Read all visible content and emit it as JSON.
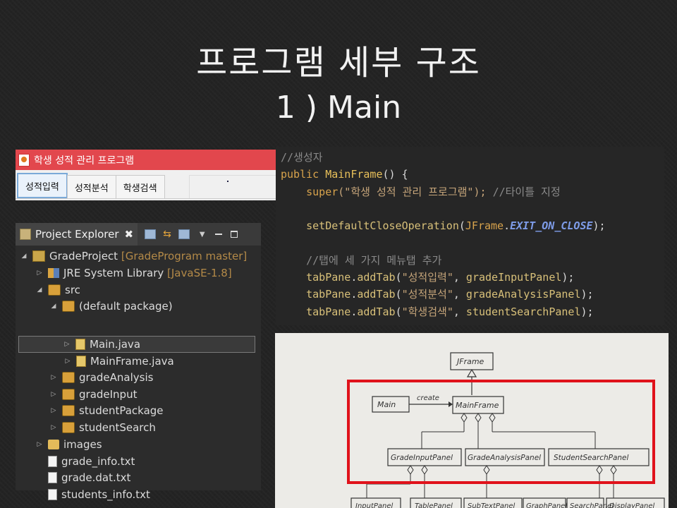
{
  "slide": {
    "title": "프로그램 세부 구조",
    "subtitle": "1 ) Main"
  },
  "app_window": {
    "title": "학생 성적 관리 프로그램",
    "tabs": [
      "성적입력",
      "성적분석",
      "학생검색"
    ],
    "active_tab": "성적입력"
  },
  "project_explorer": {
    "title": "Project Explorer",
    "close_glyph": "✖",
    "tree": [
      {
        "label": "GradeProject",
        "suffix": "[GradeProgram master]",
        "icon": "project-icon"
      },
      {
        "label": "JRE System Library",
        "suffix": "[JavaSE-1.8]",
        "icon": "library-icon"
      },
      {
        "label": "src",
        "suffix": "",
        "icon": "source-folder-icon"
      },
      {
        "label": "(default package)",
        "suffix": "",
        "icon": "package-icon"
      },
      {
        "label": "Main.java",
        "suffix": "",
        "icon": "java-file-icon"
      },
      {
        "label": "MainFrame.java",
        "suffix": "",
        "icon": "java-file-icon"
      },
      {
        "label": "gradeAnalysis",
        "suffix": "",
        "icon": "package-icon"
      },
      {
        "label": "gradeInput",
        "suffix": "",
        "icon": "package-icon"
      },
      {
        "label": "studentPackage",
        "suffix": "",
        "icon": "package-icon"
      },
      {
        "label": "studentSearch",
        "suffix": "",
        "icon": "package-icon"
      },
      {
        "label": "images",
        "suffix": "",
        "icon": "folder-icon"
      },
      {
        "label": "grade_info.txt",
        "suffix": "",
        "icon": "text-file-icon"
      },
      {
        "label": "grade.dat.txt",
        "suffix": "",
        "icon": "text-file-icon"
      },
      {
        "label": "students_info.txt",
        "suffix": "",
        "icon": "text-file-icon"
      }
    ],
    "selected": "Main.java"
  },
  "code": {
    "comment1": "//생성자",
    "public": "public",
    "ctor": "MainFrame",
    "ctor_rest": "() {",
    "super": "super",
    "super_arg": "(\"학생 성적 관리 프로그램\");",
    "super_comment": "//타이틀 지정",
    "set_close": "setDefaultCloseOperation",
    "jframe": "JFrame",
    "exit_const": "EXIT_ON_CLOSE",
    "comment2": "//탭에 세 가지 메뉴탭 추가",
    "addtab1_str": "\"성적입력\"",
    "addtab1_arg": "gradeInputPanel",
    "addtab2_str": "\"성적분석\"",
    "addtab2_arg": "gradeAnalysisPanel",
    "addtab3_str": "\"학생검색\"",
    "addtab3_arg": "studentSearchPanel",
    "tabpane": "tabPane",
    "addtab": "addTab"
  },
  "uml": {
    "root": "JFrame",
    "main": "Main",
    "relation": "create",
    "mainframe": "MainFrame",
    "panels": [
      "GradeInputPanel",
      "GradeAnalysisPanel",
      "StudentSearchPanel"
    ],
    "bottom": [
      "InputPanel",
      "TablePanel",
      "SubTextPanel",
      "GraphPanel",
      "SearchPanel",
      "DisplayPanel"
    ],
    "highlight_color": "#e0121b"
  }
}
